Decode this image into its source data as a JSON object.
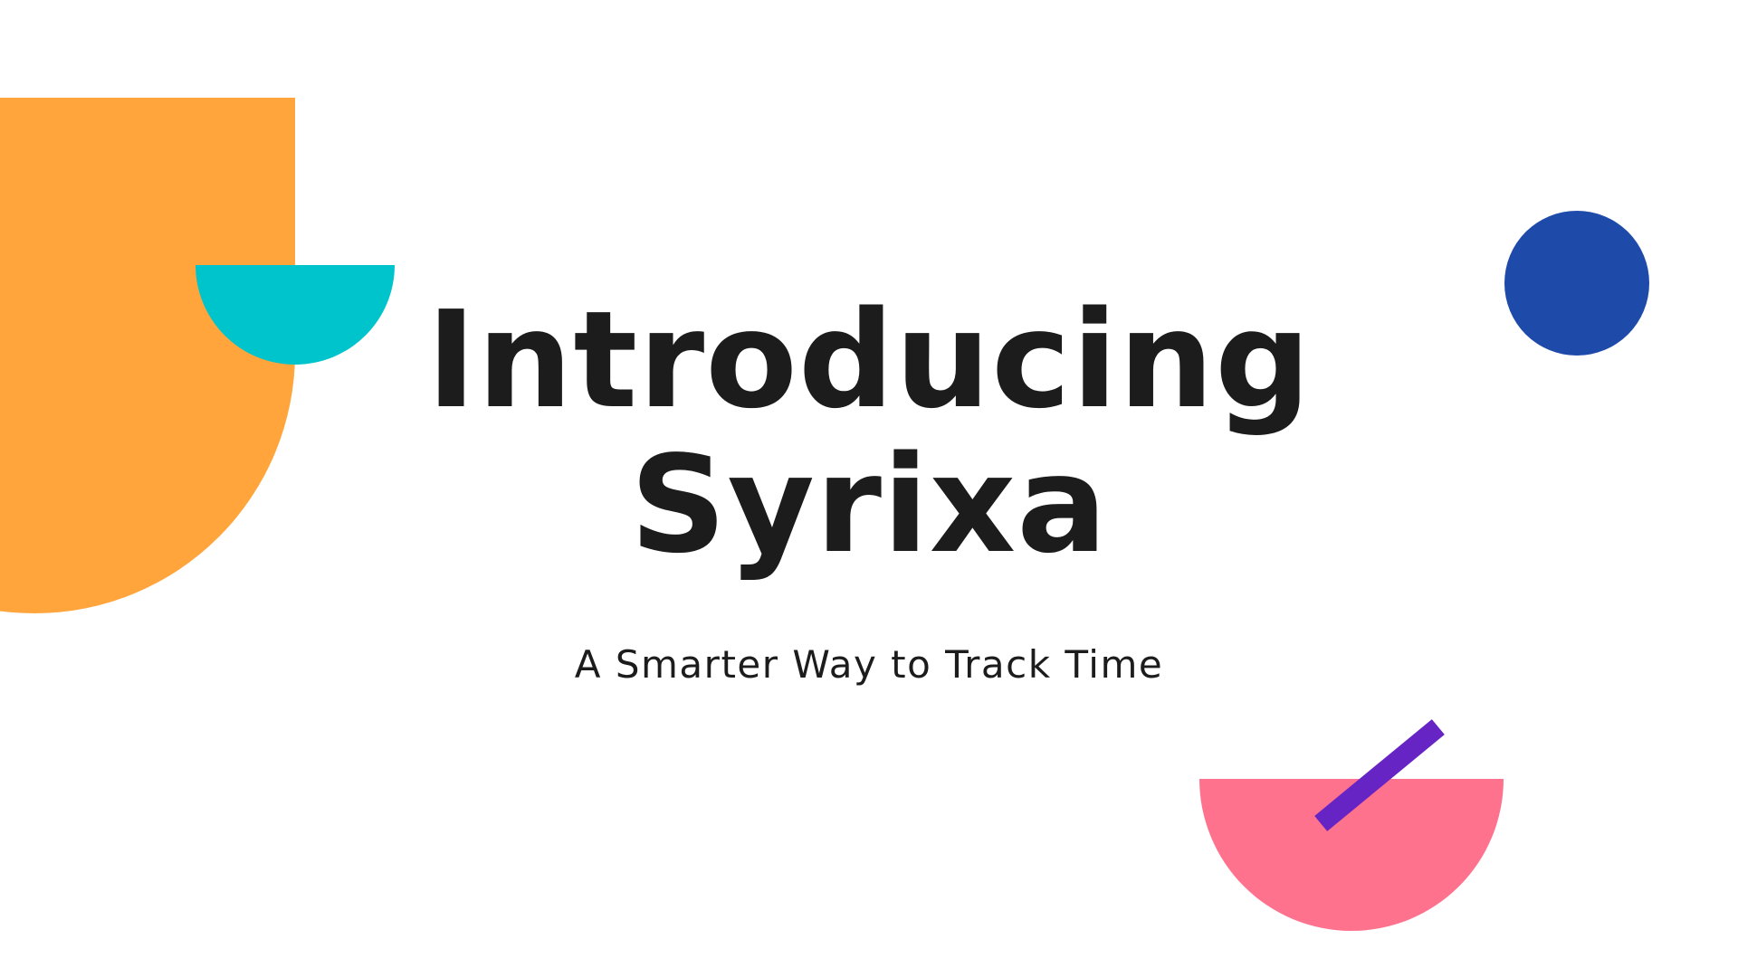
{
  "slide": {
    "title_line1": "Introducing",
    "title_line2": "Syrixa",
    "subtitle": "A Smarter Way to Track Time"
  },
  "colors": {
    "background": "#ffffff",
    "text": "#1c1c1c",
    "orange": "#ffa53c",
    "teal": "#00c4cc",
    "blue": "#1e4aaa",
    "pink": "#ff728d",
    "purple": "#6724c4"
  }
}
